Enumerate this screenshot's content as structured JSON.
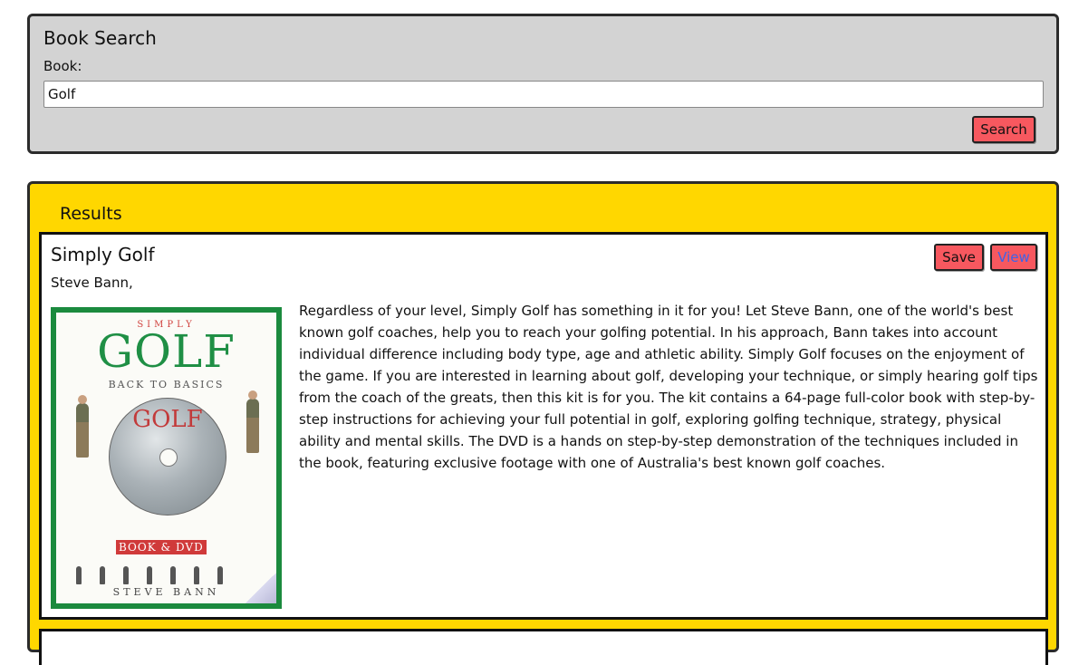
{
  "search": {
    "title": "Book Search",
    "label": "Book:",
    "value": "Golf",
    "button_label": "Search"
  },
  "results": {
    "title": "Results",
    "items": [
      {
        "title": "Simply Golf",
        "author": "Steve Bann,",
        "save_label": "Save",
        "view_label": "View",
        "description": "Regardless of your level, Simply Golf has something in it for you! Let Steve Bann, one of the world's best known golf coaches, help you to reach your golfing potential. In his approach, Bann takes into account individual difference including body type, age and athletic ability. Simply Golf focuses on the enjoyment of the game. If you are interested in learning about golf, developing your technique, or simply hearing golf tips from the coach of the greats, then this kit is for you. The kit contains a 64-page full-color book with step-by-step instructions for achieving your full potential in golf, exploring golfing technique, strategy, physical ability and mental skills. The DVD is a hands on step-by-step demonstration of the techniques included in the book, featuring exclusive footage with one of Australia's best known golf coaches.",
        "cover": {
          "simply": "SIMPLY",
          "golf": "GOLF",
          "subtitle": "BACK TO BASICS",
          "banner": "BOOK & DVD",
          "author": "STEVE BANN"
        }
      }
    ]
  },
  "colors": {
    "search_panel_bg": "#d3d3d3",
    "results_panel_bg": "#ffd700",
    "button_bg": "#f7585f",
    "view_text": "#3f63e8"
  }
}
